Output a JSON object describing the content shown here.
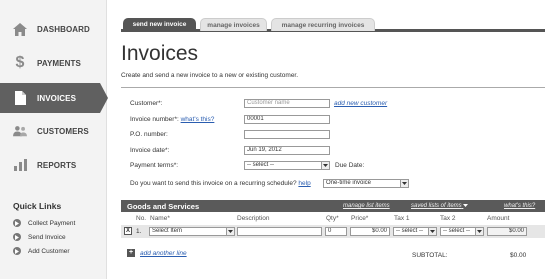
{
  "sidebar": {
    "items": [
      {
        "label": "DASHBOARD",
        "icon": "home-icon"
      },
      {
        "label": "PAYMENTS",
        "icon": "dollar-icon"
      },
      {
        "label": "INVOICES",
        "icon": "document-icon",
        "active": true
      },
      {
        "label": "CUSTOMERS",
        "icon": "users-icon"
      },
      {
        "label": "REPORTS",
        "icon": "bar-chart-icon"
      }
    ],
    "quick_links_title": "Quick Links",
    "quick_links": [
      {
        "label": "Collect Payment",
        "icon": "arrow-right-icon"
      },
      {
        "label": "Send Invoice",
        "icon": "arrow-right-icon"
      },
      {
        "label": "Add Customer",
        "icon": "arrow-right-icon"
      }
    ]
  },
  "tabs": [
    {
      "label": "send new invoice",
      "active": true
    },
    {
      "label": "manage invoices",
      "active": false
    },
    {
      "label": "manage recurring invoices",
      "active": false
    }
  ],
  "page": {
    "title": "Invoices",
    "description": "Create and send a new invoice to a new or existing customer."
  },
  "form": {
    "customer_label": "Customer*:",
    "customer_placeholder": "Customer name",
    "add_new_customer": "add new customer",
    "invoice_number_label": "Invoice number*:",
    "whats_this": "what's this?",
    "invoice_number_value": "00001",
    "po_number_label": "P.O. number:",
    "po_number_value": "",
    "invoice_date_label": "Invoice date*:",
    "invoice_date_value": "Jun 19, 2012",
    "payment_terms_label": "Payment terms*:",
    "payment_terms_value": "-- select --",
    "due_date_label": "Due Date:",
    "recurring_question": "Do you want to send this invoice on a recurring schedule?",
    "help_link": "help",
    "recurring_value": "One-time invoice"
  },
  "goods": {
    "title": "Goods and Services",
    "manage_list_items": "manage list items",
    "saved_lists": "saved lists of items",
    "whats_this": "what's this?",
    "columns": {
      "no": "No.",
      "name": "Name*",
      "description": "Description",
      "qty": "Qty*",
      "price": "Price*",
      "tax1": "Tax 1",
      "tax2": "Tax 2",
      "amount": "Amount"
    },
    "row": {
      "remove": "X",
      "number": "1.",
      "name_select": "Select Item",
      "description": "",
      "qty": "0",
      "price": "$0.00",
      "tax1": "-- select --",
      "tax2": "-- select --",
      "amount": "$0.00"
    },
    "add_line": "add another line",
    "subtotal_label": "SUBTOTAL:",
    "subtotal_value": "$0.00"
  }
}
